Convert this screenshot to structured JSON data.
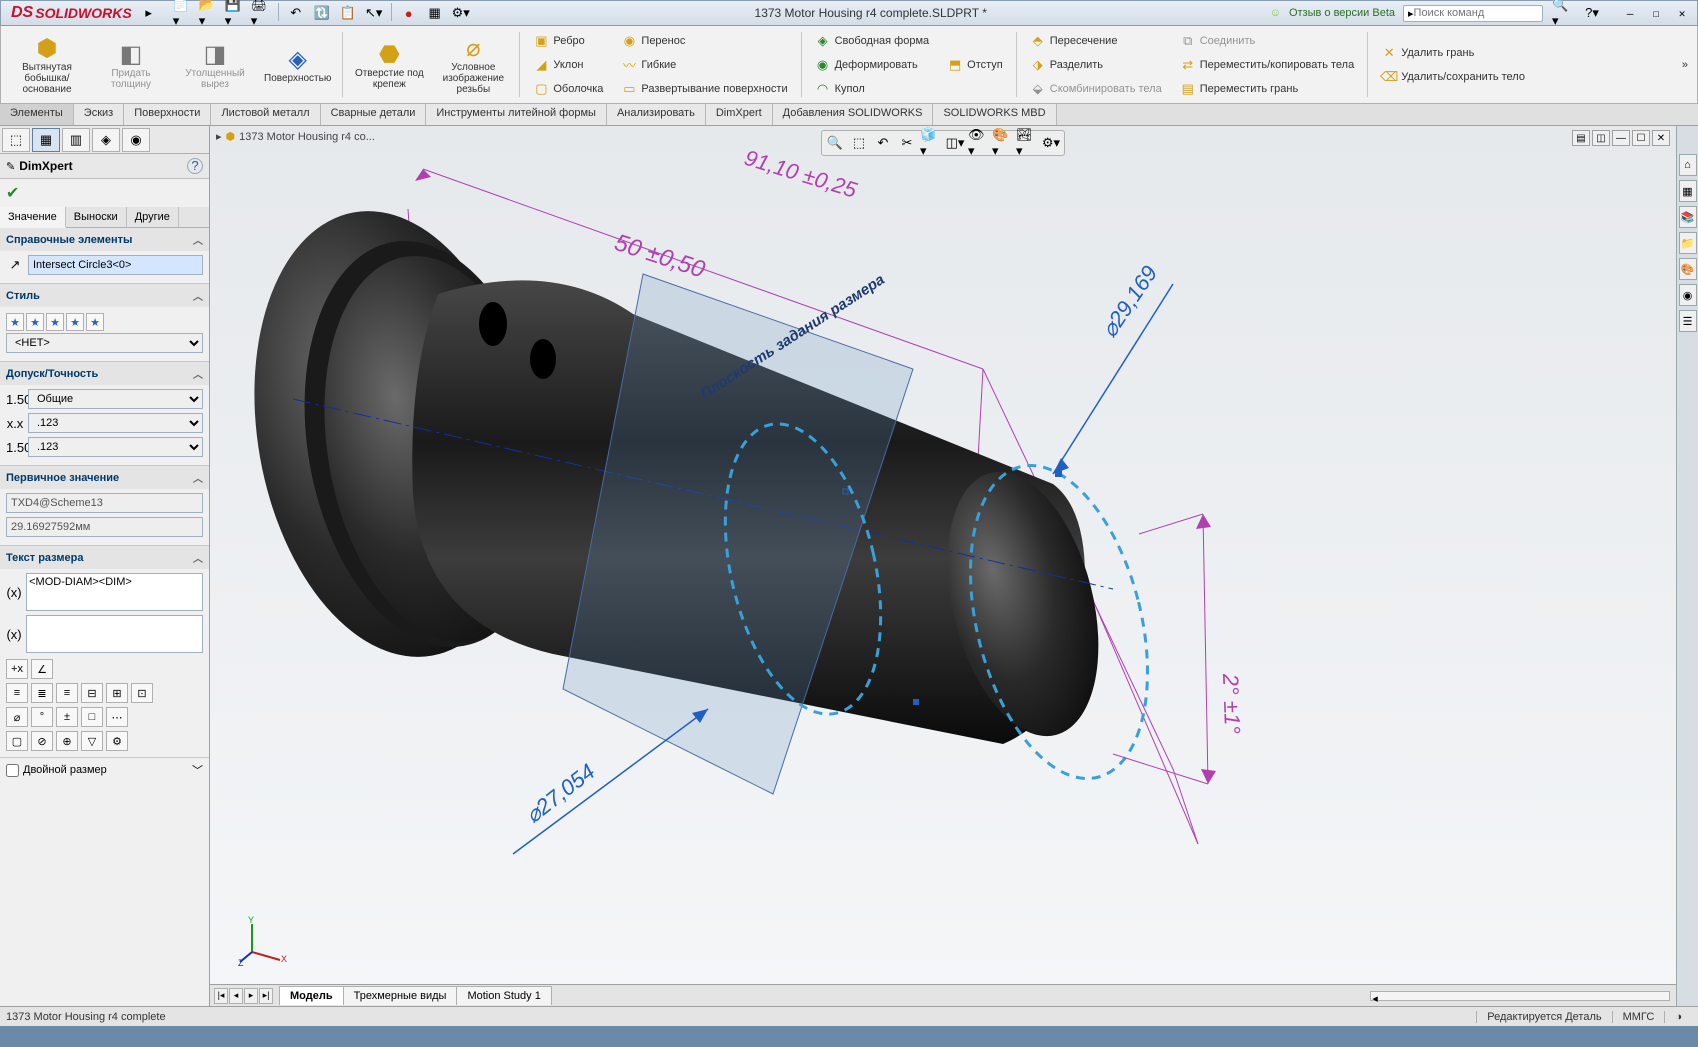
{
  "app": {
    "name": "SOLIDWORKS",
    "title": "1373 Motor Housing r4 complete.SLDPRT *"
  },
  "beta": "Отзыв о версии Beta",
  "search": {
    "placeholder": "Поиск команд"
  },
  "ribbon": {
    "big": [
      {
        "label": "Вытянутая бобышка/основание"
      },
      {
        "label": "Придать толщину"
      },
      {
        "label": "Утолщенный вырез"
      },
      {
        "label": "Поверхностью"
      },
      {
        "label": "Отверстие под крепеж"
      },
      {
        "label": "Условное изображение резьбы"
      }
    ],
    "cols": [
      [
        {
          "l": "Ребро"
        },
        {
          "l": "Уклон"
        },
        {
          "l": "Оболочка"
        }
      ],
      [
        {
          "l": "Перенос"
        },
        {
          "l": "Гибкие"
        },
        {
          "l": "Развертывание поверхности"
        }
      ],
      [
        {
          "l": "Свободная форма"
        },
        {
          "l": "Деформировать"
        },
        {
          "l": "Купол"
        }
      ],
      [
        {
          "l": "Отступ"
        }
      ],
      [
        {
          "l": "Пересечение"
        },
        {
          "l": "Разделить"
        },
        {
          "l": "Скомбинировать тела"
        }
      ],
      [
        {
          "l": "Соединить"
        },
        {
          "l": "Переместить/копировать тела"
        },
        {
          "l": "Переместить грань"
        }
      ],
      [
        {
          "l": "Удалить грань"
        },
        {
          "l": "Удалить/сохранить тело"
        }
      ]
    ]
  },
  "ftabs": [
    "Элементы",
    "Эскиз",
    "Поверхности",
    "Листовой металл",
    "Сварные детали",
    "Инструменты литейной формы",
    "Анализировать",
    "DimXpert",
    "Добавления SOLIDWORKS",
    "SOLIDWORKS MBD"
  ],
  "breadcrumb": "1373 Motor Housing r4 co...",
  "pm": {
    "title": "DimXpert",
    "subtabs": [
      "Значение",
      "Выноски",
      "Другие"
    ],
    "ref_sec": "Справочные элементы",
    "ref_val": "Intersect Circle3<0>",
    "style_sec": "Стиль",
    "style_none": "<НЕТ>",
    "tol_sec": "Допуск/Точность",
    "tol_type": "Общие",
    "tol_prec1": ".123",
    "tol_prec2": ".123",
    "prim_sec": "Первичное значение",
    "prim_name": "TXD4@Scheme13",
    "prim_val": "29.16927592мм",
    "text_sec": "Текст размера",
    "text_val": "<MOD-DIAM><DIM>",
    "dual": "Двойной размер"
  },
  "viewport": {
    "dim1": "50 ±0,50",
    "dim_top": "91,10 ±0,25",
    "dim_dia": "⌀29,169",
    "dim_dia2": "⌀27,054",
    "dim_ang": "2° ±1°",
    "plane": "Плоскость задания размера"
  },
  "btabs": [
    "Модель",
    "Трехмерные виды",
    "Motion Study 1"
  ],
  "status": {
    "left": "1373 Motor Housing r4 complete",
    "edit": "Редактируется Деталь",
    "units": "ММГС"
  }
}
